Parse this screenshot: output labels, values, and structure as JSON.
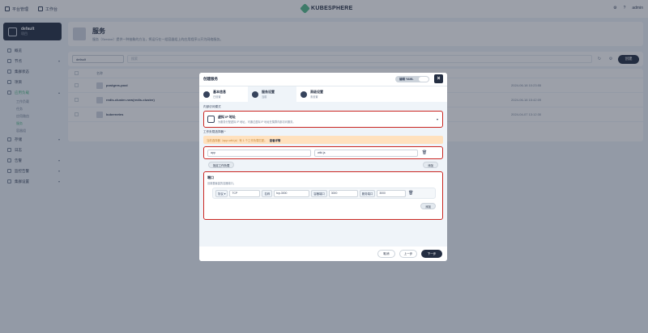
{
  "topbar": {
    "platform_label": "平台管理",
    "workbench_label": "工作台",
    "logo_text": "KUBESPHERE",
    "user_name": "admin"
  },
  "sidebar": {
    "project_name": "default",
    "project_sub": "项目",
    "items": [
      {
        "label": "概览"
      },
      {
        "label": "节点"
      },
      {
        "label": "集群状态"
      },
      {
        "label": "项目"
      },
      {
        "label": "应用负载"
      }
    ],
    "sub_items": [
      {
        "label": "工作负载"
      },
      {
        "label": "任务"
      },
      {
        "label": "应用路由"
      },
      {
        "label": "服务"
      },
      {
        "label": "容器组"
      }
    ],
    "items_bottom": [
      {
        "label": "存储"
      },
      {
        "label": "日志"
      },
      {
        "label": "告警"
      },
      {
        "label": "监控告警"
      },
      {
        "label": "集群设置"
      }
    ]
  },
  "page": {
    "title": "服务",
    "description": "服务（Service）提供一种抽象的方法，将运行在一组容器组上的应用程序公开为网络服务。"
  },
  "toolbar": {
    "namespace": "default",
    "search_placeholder": "搜索",
    "create_label": "创建"
  },
  "table": {
    "header_name": "名称",
    "rows": [
      {
        "name": "postgres-pool",
        "time": "2024-06-18 10:23:55"
      },
      {
        "name": "redis-cluster-new(redis-cluster)",
        "time": "2024-06-18 15:42:09"
      },
      {
        "name": "kubernetes",
        "time": "2024-04-07 13:12:30"
      }
    ]
  },
  "modal": {
    "title": "创建服务",
    "yaml_label": "编辑 YAML",
    "steps": [
      {
        "title": "基本信息",
        "sub": "已设置"
      },
      {
        "title": "服务设置",
        "sub": "当前"
      },
      {
        "title": "高级设置",
        "sub": "未设置"
      }
    ],
    "access_mode_label": "内部访问模式",
    "access_title": "虚拟 IP 地址",
    "access_desc": "为服务分配虚拟 IP 地址，可通过虚拟 IP 地址在集群内部访问服务。",
    "selector_label": "工作负载选择器 *",
    "warning_text": "当前选择器（app=wiki.js）有 1 个工作负载匹配。",
    "warning_link": "查看详情",
    "selector_key": "app",
    "selector_value": "wiki.js",
    "specify_workload": "指定工作负载",
    "add_label": "添加",
    "ports_title": "端口",
    "ports_desc": "设置要暴露的容器端口。",
    "port": {
      "protocol_tag": "协议 ▾",
      "protocol": "TCP",
      "name_tag": "名称",
      "name": "tcp-3000",
      "container_port_tag": "容器端口",
      "container_port": "3000",
      "service_port_tag": "服务端口",
      "service_port": "3000"
    },
    "cancel": "取消",
    "prev": "上一步",
    "next": "下一步"
  }
}
